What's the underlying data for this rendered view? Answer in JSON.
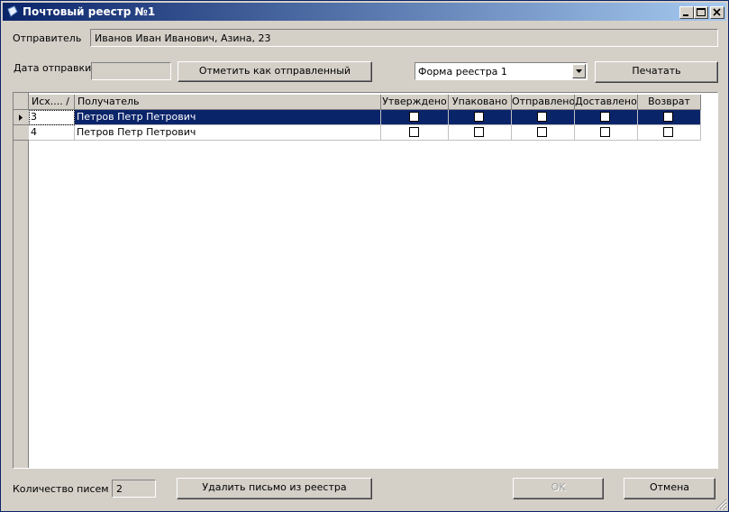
{
  "window": {
    "title": "Почтовый реестр №1"
  },
  "sender": {
    "label": "Отправитель",
    "value": "Иванов Иван Иванович, Азина, 23"
  },
  "send_date": {
    "label": "Дата отправки",
    "value": ""
  },
  "mark_sent_button": "Отметить как отправленный",
  "form_select": {
    "value": "Форма реестра 1"
  },
  "print_button": "Печатать",
  "table": {
    "columns": [
      "Исх.... /",
      "Получатель",
      "Утверждено",
      "Упаковано",
      "Отправлено",
      "Доставлено",
      "Возврат"
    ],
    "rows": [
      {
        "num": "3",
        "recipient": "Петров Петр Петрович",
        "approved": false,
        "packed": false,
        "sent": false,
        "delivered": false,
        "returned": false,
        "selected": true
      },
      {
        "num": "4",
        "recipient": "Петров Петр Петрович",
        "approved": false,
        "packed": false,
        "sent": false,
        "delivered": false,
        "returned": false,
        "selected": false
      }
    ]
  },
  "letters_count": {
    "label": "Количество писем",
    "value": "2"
  },
  "delete_button": "Удалить письмо из реестра",
  "ok_button": "OK",
  "cancel_button": "Отмена"
}
